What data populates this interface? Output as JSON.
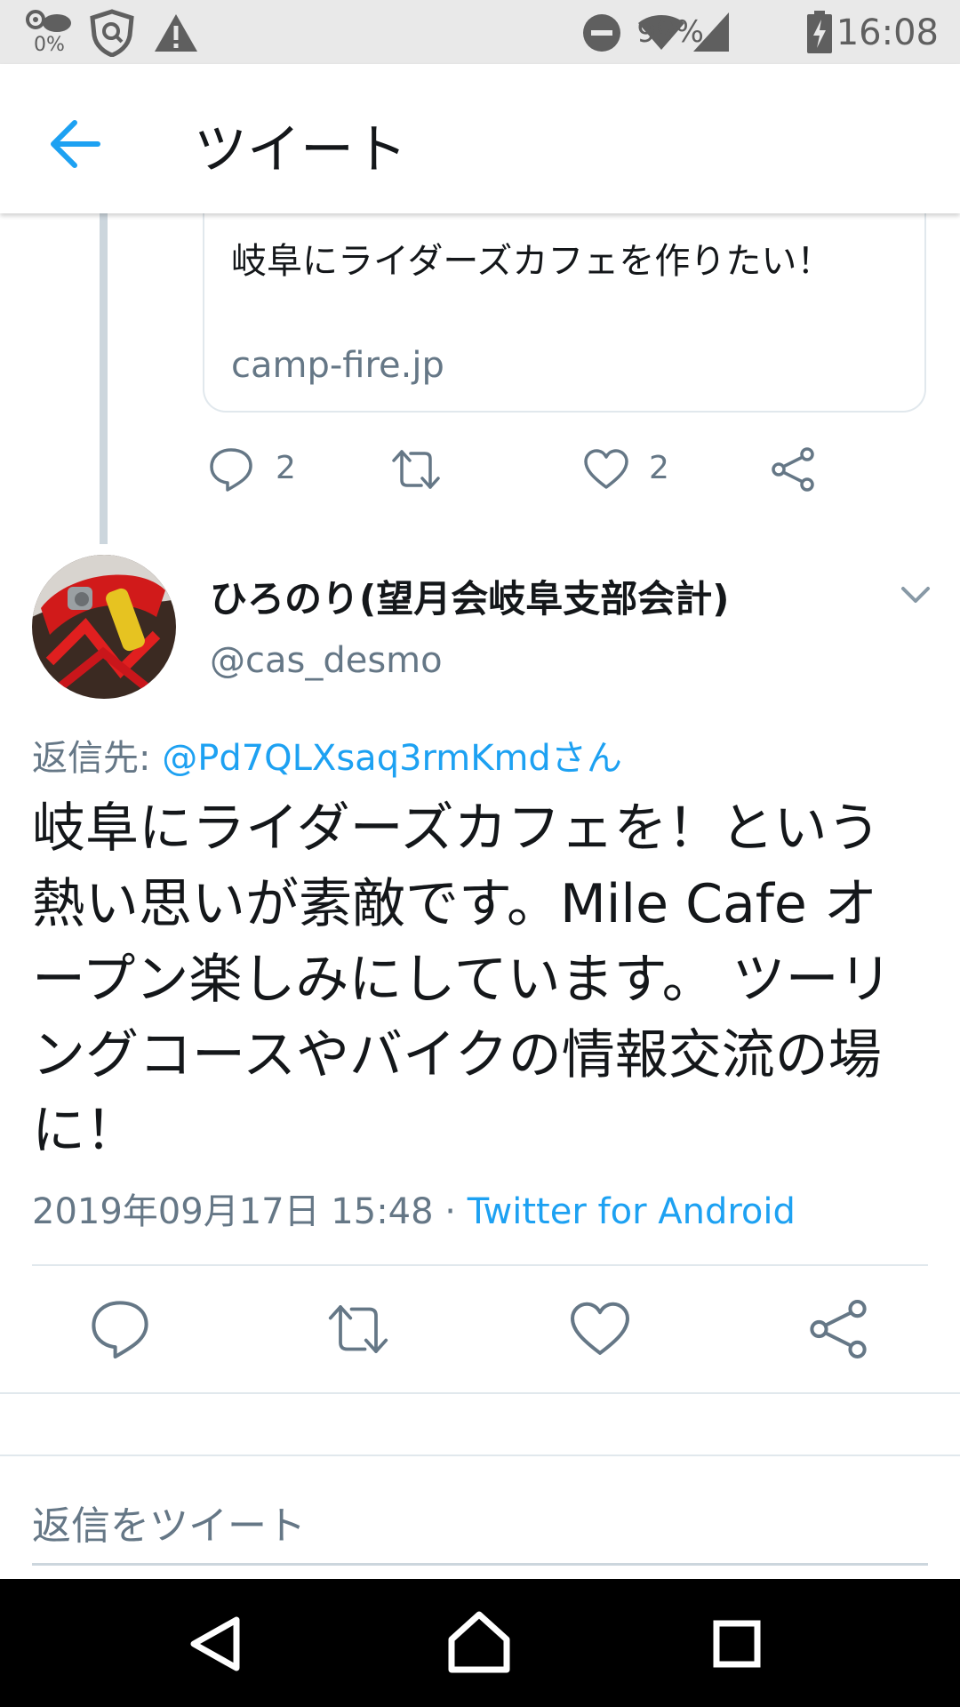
{
  "status_bar": {
    "data_small": "0%",
    "battery_percent": "99%",
    "time": "16:08"
  },
  "app_bar": {
    "title": "ツイート"
  },
  "link_card": {
    "title": "岐阜にライダーズカフェを作りたい！",
    "domain": "camp-fire.jp"
  },
  "parent_actions": {
    "reply_count": "2",
    "like_count": "2"
  },
  "tweet": {
    "author_name": "ひろのり(望月会岐阜支部会計)",
    "author_handle": "@cas_desmo",
    "reply_prefix": "返信先: ",
    "reply_mention": "@Pd7QLXsaq3rmKmdさん",
    "text": "岐阜にライダーズカフェを！という熱い思いが素敵です。Mile Cafe オープン楽しみにしています。 ツーリングコースやバイクの情報交流の場に！",
    "timestamp": "2019年09月17日 15:48 · ",
    "source": "Twitter for Android"
  },
  "reply_box": {
    "placeholder": "返信をツイート"
  },
  "colors": {
    "accent": "#1da1f2",
    "secondary_text": "#657786",
    "divider": "#e1e8ed"
  },
  "icons": {
    "status": [
      "data-saver-icon",
      "shield-icon",
      "warning-icon",
      "dnd-icon",
      "wifi-icon",
      "signal-icon",
      "battery-charging-icon"
    ],
    "app_bar": [
      "back-arrow-icon"
    ],
    "actions": [
      "reply-icon",
      "retweet-icon",
      "like-icon",
      "share-icon"
    ],
    "nav": [
      "nav-back-icon",
      "nav-home-icon",
      "nav-recents-icon"
    ]
  }
}
